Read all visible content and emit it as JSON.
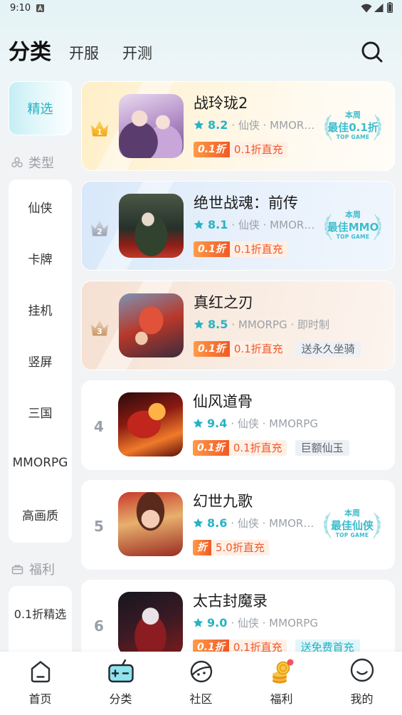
{
  "status_bar": {
    "time": "9:10",
    "icons": [
      "notification-icon",
      "wifi-icon",
      "signal-icon",
      "battery-icon"
    ]
  },
  "header": {
    "title": "分类",
    "tabs": [
      {
        "label": "开服"
      },
      {
        "label": "开测"
      }
    ],
    "search_icon": "search-icon"
  },
  "sidebar": {
    "featured": {
      "label": "精选",
      "selected": true
    },
    "type_section": {
      "title": "类型",
      "icon": "category-icon",
      "items": [
        "仙侠",
        "卡牌",
        "挂机",
        "竖屏",
        "三国",
        "MMORPG",
        "高画质"
      ]
    },
    "welfare_section": {
      "title": "福利",
      "icon": "gift-icon",
      "items": [
        "0.1折精选"
      ]
    }
  },
  "games": [
    {
      "rank": "1",
      "rank_icon": "gold-crown-icon",
      "title": "战玲珑2",
      "rating": "8.2",
      "meta": "· 仙侠 · MMOR…",
      "discount": "0.1折",
      "recharge": "0.1折直充",
      "badge": {
        "week": "本周",
        "label": "最佳0.1折",
        "sub": "TOP GAME"
      }
    },
    {
      "rank": "2",
      "rank_icon": "silver-crown-icon",
      "title": "绝世战魂：前传",
      "rating": "8.1",
      "meta": "· 仙侠 · MMOR…",
      "discount": "0.1折",
      "recharge": "0.1折直充",
      "badge": {
        "week": "本周",
        "label": "最佳MMO",
        "sub": "TOP GAME"
      }
    },
    {
      "rank": "3",
      "rank_icon": "bronze-crown-icon",
      "title": "真红之刃",
      "rating": "8.5",
      "meta": "· MMORPG · 即时制",
      "discount": "0.1折",
      "recharge": "0.1折直充",
      "extra_tag": "送永久坐骑"
    },
    {
      "rank": "4",
      "title": "仙风道骨",
      "rating": "9.4",
      "meta": "· 仙侠 · MMORPG",
      "discount": "0.1折",
      "recharge": "0.1折直充",
      "extra_tag": "巨额仙玉"
    },
    {
      "rank": "5",
      "title": "幻世九歌",
      "rating": "8.6",
      "meta": "· 仙侠 · MMOR…",
      "discount": "折",
      "recharge": "5.0折直充",
      "badge": {
        "week": "本周",
        "label": "最佳仙侠",
        "sub": "TOP GAME"
      }
    },
    {
      "rank": "6",
      "title": "太古封魔录",
      "rating": "9.0",
      "meta": "· 仙侠 · MMORPG",
      "discount": "0.1折",
      "recharge": "0.1折直充",
      "extra_tag": "送免费首充",
      "extra_tag_style": "highlight"
    }
  ],
  "bottom_nav": [
    {
      "label": "首页",
      "icon": "home-icon",
      "selected": false
    },
    {
      "label": "分类",
      "icon": "category-gamepad-icon",
      "selected": true
    },
    {
      "label": "社区",
      "icon": "community-icon",
      "selected": false
    },
    {
      "label": "福利",
      "icon": "coins-icon",
      "selected": false,
      "badge_dot": true
    },
    {
      "label": "我的",
      "icon": "profile-smile-icon",
      "selected": false
    }
  ],
  "colors": {
    "accent": "#27b3c5",
    "discount_orange": "#f15a24",
    "recharge_text": "#f0592a",
    "rank_gold": "#f5b52e",
    "rank_silver": "#aab2bf",
    "rank_bronze": "#d4a87e",
    "badge_teal": "#3ebccc",
    "notification_dot": "#f4545c"
  }
}
